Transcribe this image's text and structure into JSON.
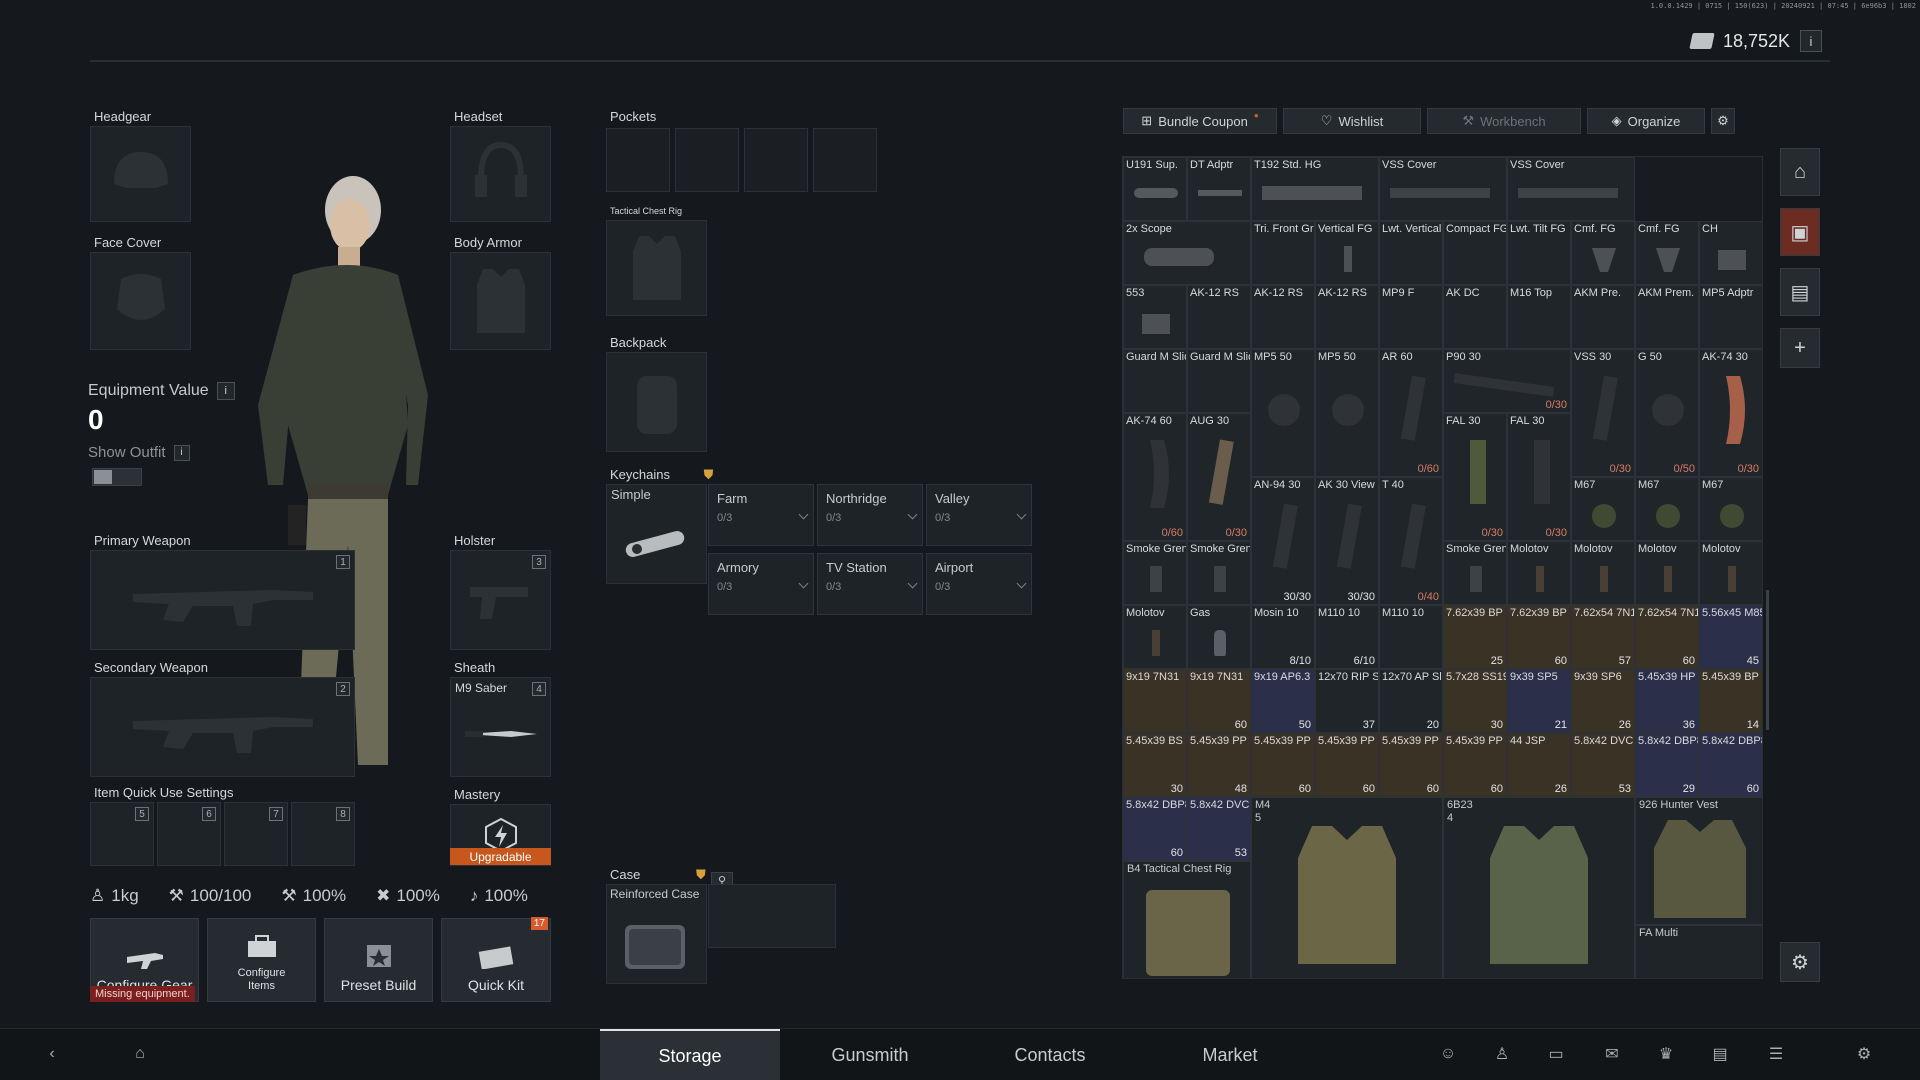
{
  "build_info": "1.0.0.1429 | 0715 | 150(623) | 20240921 | 07:45 | 6e96b3 | 1802",
  "currency": {
    "amount": "18,752K",
    "info": "i"
  },
  "equipment": {
    "headgear": "Headgear",
    "headset": "Headset",
    "face_cover": "Face Cover",
    "body_armor": "Body Armor",
    "primary_weapon": "Primary Weapon",
    "primary_num": "1",
    "holster": "Holster",
    "holster_num": "3",
    "secondary_weapon": "Secondary Weapon",
    "secondary_num": "2",
    "sheath": "Sheath",
    "sheath_num": "4",
    "sheath_item": "M9 Saber",
    "quick_use": "Item Quick Use Settings",
    "quick_slots": [
      "5",
      "6",
      "7",
      "8"
    ],
    "mastery": "Mastery",
    "mastery_status": "Upgradable",
    "equipment_value_label": "Equipment Value",
    "equipment_value": "0",
    "show_outfit": "Show Outfit"
  },
  "stats": {
    "weight": "1kg",
    "durability": "100/100",
    "stat2": "100%",
    "stat3": "100%",
    "stat4": "100%"
  },
  "actions": {
    "configure_gear": "Configure Gear",
    "configure_items_1": "Configure",
    "configure_items_2": "Items",
    "preset_build": "Preset Build",
    "quick_kit": "Quick Kit",
    "quick_kit_badge": "17",
    "missing": "Missing equipment."
  },
  "containers": {
    "pockets": "Pockets",
    "tactical_chest_rig": "Tactical Chest Rig",
    "backpack": "Backpack",
    "keychains": "Keychains",
    "keychain_simple": "Simple",
    "case": "Case",
    "case_item": "Reinforced Case"
  },
  "keychain_options": [
    {
      "name": "Farm",
      "count": "0/3"
    },
    {
      "name": "Northridge",
      "count": "0/3"
    },
    {
      "name": "Valley",
      "count": "0/3"
    },
    {
      "name": "Armory",
      "count": "0/3"
    },
    {
      "name": "TV Station",
      "count": "0/3"
    },
    {
      "name": "Airport",
      "count": "0/3"
    }
  ],
  "storage_tabs": {
    "bundle": "Bundle Coupon",
    "wishlist": "Wishlist",
    "workbench": "Workbench",
    "organize": "Organize"
  },
  "storage_items": [
    {
      "n": "U191 Sup.",
      "c": ""
    },
    {
      "n": "DT Adptr",
      "c": ""
    },
    {
      "n": "T192 Std. HG",
      "c": ""
    },
    {
      "n": "VSS Cover",
      "c": ""
    },
    {
      "n": "VSS Cover",
      "c": ""
    },
    {
      "n": "",
      "c": ""
    },
    {
      "n": "2x Scope",
      "c": ""
    },
    {
      "n": "Tri. Front Grip",
      "c": ""
    },
    {
      "n": "Vertical FG",
      "c": ""
    },
    {
      "n": "Lwt. Vertical",
      "c": ""
    },
    {
      "n": "Compact FG",
      "c": ""
    },
    {
      "n": "Lwt. Tilt FG",
      "c": ""
    },
    {
      "n": "553",
      "c": ""
    },
    {
      "n": "AK-12 RS",
      "c": ""
    },
    {
      "n": "AK-12 RS",
      "c": ""
    },
    {
      "n": "AK-12 RS",
      "c": ""
    },
    {
      "n": "MP9 F",
      "c": ""
    },
    {
      "n": "AK DC",
      "c": ""
    },
    {
      "n": "Guard M Slide",
      "c": ""
    },
    {
      "n": "Guard M Slide",
      "c": ""
    },
    {
      "n": "MP5 50",
      "c": ""
    },
    {
      "n": "MP5 50",
      "c": ""
    },
    {
      "n": "AR 60",
      "c": "0/60"
    },
    {
      "n": "P90 30",
      "c": "0/30"
    },
    {
      "n": "AK-74 60",
      "c": "0/60"
    },
    {
      "n": "AUG 30",
      "c": "0/30"
    },
    {
      "n": "AN-94 30",
      "c": "30/30"
    },
    {
      "n": "AK 30 View",
      "c": "30/30"
    },
    {
      "n": "T 40",
      "c": "0/40"
    },
    {
      "n": "FAL 30",
      "c": "0/30"
    },
    {
      "n": "Smoke Gren.",
      "c": ""
    },
    {
      "n": "Smoke Gren.",
      "c": ""
    },
    {
      "n": "Molotov",
      "c": "8/10"
    },
    {
      "n": "Gas",
      "c": ""
    },
    {
      "n": "Mosin 10",
      "c": "8/10"
    },
    {
      "n": "M110 10",
      "c": "6/10"
    }
  ],
  "grid_cols_right": [
    {
      "n": "Cmf. FG",
      "c": ""
    },
    {
      "n": "Cmf. FG",
      "c": ""
    },
    {
      "n": "CH",
      "c": ""
    },
    {
      "n": "M16 Top",
      "c": ""
    },
    {
      "n": "AKM Pre.",
      "c": ""
    },
    {
      "n": "AKM Prem. Fl.",
      "c": ""
    },
    {
      "n": "MP5 Adptr",
      "c": ""
    },
    {
      "n": "VSS 30",
      "c": "0/30"
    },
    {
      "n": "G 50",
      "c": "0/50"
    },
    {
      "n": "AK-74 30",
      "c": "0/30"
    },
    {
      "n": "FAL 30",
      "c": "0/30"
    },
    {
      "n": "M67",
      "c": ""
    },
    {
      "n": "M67",
      "c": ""
    },
    {
      "n": "M67",
      "c": ""
    }
  ],
  "ammo": [
    {
      "n": "7.62x39 BP",
      "c": "25"
    },
    {
      "n": "7.62x39 BP",
      "c": "60"
    },
    {
      "n": "7.62x54 7N1",
      "c": "57"
    },
    {
      "n": "7.62x54 7N1",
      "c": "60"
    },
    {
      "n": "5.56x45 M855",
      "c": "45"
    },
    {
      "n": "9x19 7N31",
      "c": ""
    },
    {
      "n": "9x19 7N31",
      "c": "60"
    },
    {
      "n": "9x19 AP6.3",
      "c": "50"
    },
    {
      "n": "12x70 RIP Slug",
      "c": "37"
    },
    {
      "n": "12x70 AP Slug",
      "c": "20"
    },
    {
      "n": "5.7x28 SS190",
      "c": "30"
    },
    {
      "n": "9x39 SP5",
      "c": "21"
    },
    {
      "n": "9x39 SP6",
      "c": "26"
    },
    {
      "n": "5.45x39 HP",
      "c": "36"
    },
    {
      "n": "5.45x39 BP",
      "c": "14"
    },
    {
      "n": "5.45x39 BS",
      "c": "30"
    },
    {
      "n": "5.45x39 PP",
      "c": "48"
    },
    {
      "n": "5.45x39 PP",
      "c": "60"
    },
    {
      "n": "5.45x39 PP",
      "c": "60"
    },
    {
      "n": "5.45x39 PP",
      "c": "60"
    },
    {
      "n": "5.45x39 PP",
      "c": "60"
    },
    {
      "n": "44 JSP",
      "c": "26"
    },
    {
      "n": "5.8x42 DVC12",
      "c": "53"
    },
    {
      "n": "5.8x42 DBP87",
      "c": "29"
    },
    {
      "n": "5.8x42 DBP87",
      "c": "60"
    },
    {
      "n": "5.8x42 DBP87",
      "c": "60"
    },
    {
      "n": "5.8x42 DVC12",
      "c": "53"
    }
  ],
  "gear_items": {
    "m4": "M4",
    "m4_count": "5",
    "b4": "B4 Tactical Chest Rig",
    "sixb23": "6B23",
    "sixb23_count": "4",
    "hunter": "926 Hunter Vest",
    "fa": "FA Multi"
  },
  "nav": {
    "storage": "Storage",
    "gunsmith": "Gunsmith",
    "contacts": "Contacts",
    "market": "Market"
  }
}
